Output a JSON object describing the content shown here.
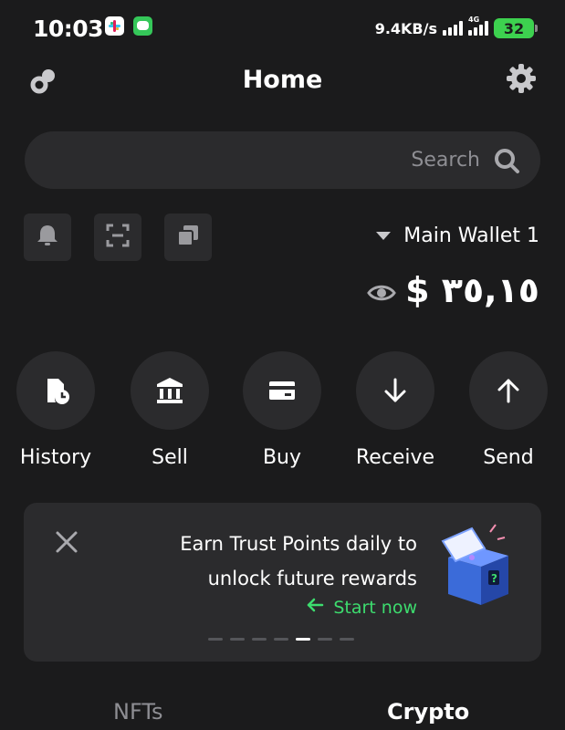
{
  "status_bar": {
    "time": "10:03",
    "network_speed": "9.4KB/s",
    "network_type": "4G",
    "battery": "32"
  },
  "header": {
    "title": "Home",
    "left_icon": "link-icon",
    "right_icon": "gear-icon"
  },
  "search": {
    "placeholder": "Search"
  },
  "quick_actions": [
    "bell-icon",
    "scan-icon",
    "copy-icon"
  ],
  "wallet": {
    "name": "Main Wallet 1",
    "balance": "$ ٣٥,١٥"
  },
  "actions": [
    {
      "label": "History",
      "icon": "history-icon"
    },
    {
      "label": "Sell",
      "icon": "bank-icon"
    },
    {
      "label": "Buy",
      "icon": "card-icon"
    },
    {
      "label": "Receive",
      "icon": "arrow-down-icon"
    },
    {
      "label": "Send",
      "icon": "arrow-up-icon"
    }
  ],
  "promo": {
    "line1": "Earn Trust Points daily to",
    "line2": "unlock future rewards",
    "cta": "Start now",
    "page_count": 7,
    "active_page": 5
  },
  "tabs": {
    "nfts": "NFTs",
    "crypto": "Crypto",
    "active": "Crypto"
  },
  "colors": {
    "background": "#1b1b1c",
    "surface": "#2b2b2d",
    "accent_green": "#3ddc6e",
    "battery_green": "#3dd14f",
    "muted_text": "#8e8e93"
  }
}
